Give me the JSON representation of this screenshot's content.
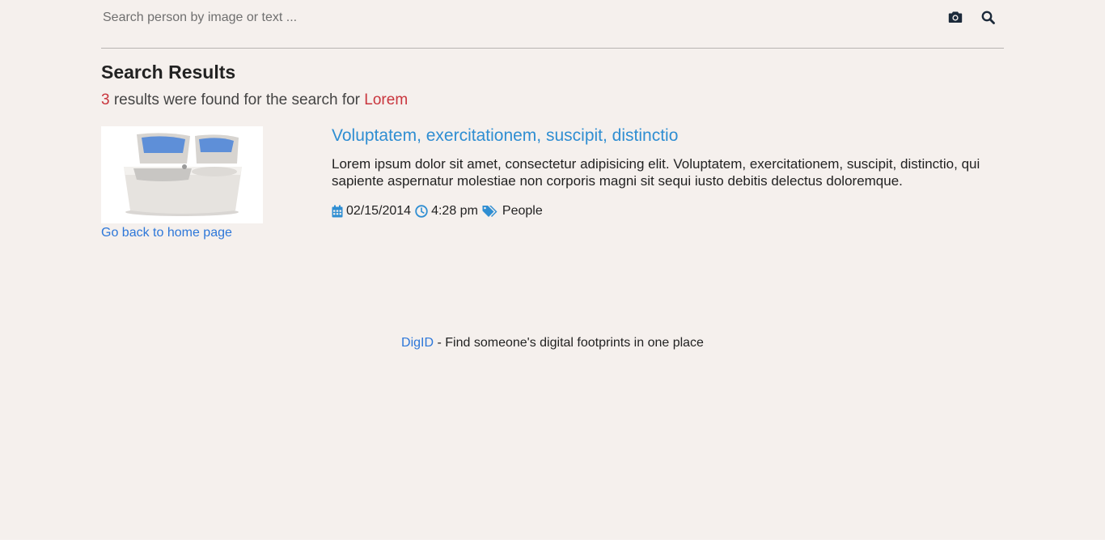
{
  "search": {
    "placeholder": "Search person by image or text ...",
    "camera_icon": "camera-icon",
    "search_icon": "search-icon"
  },
  "results": {
    "heading": "Search Results",
    "count": "3",
    "summary_text": " results were found for the search for ",
    "query": "Lorem"
  },
  "result": {
    "image_alt": "washing machine",
    "title": "Voluptatem, exercitationem, suscipit, distinctio",
    "description": "Lorem ipsum dolor sit amet, consectetur adipisicing elit. Voluptatem, exercitationem, suscipit, distinctio, qui sapiente aspernatur molestiae non corporis magni sit sequi iusto debitis delectus doloremque.",
    "date": "02/15/2014",
    "time": "4:28 pm",
    "tag": "People"
  },
  "home_link": "Go back to home page",
  "footer": {
    "brand": "DigID",
    "tagline": " - Find someone's digital footprints in one place"
  },
  "colors": {
    "background": "#f5f0ed",
    "accent_red": "#c9353d",
    "link_blue": "#2d77d9",
    "title_blue": "#2f8ed2"
  }
}
